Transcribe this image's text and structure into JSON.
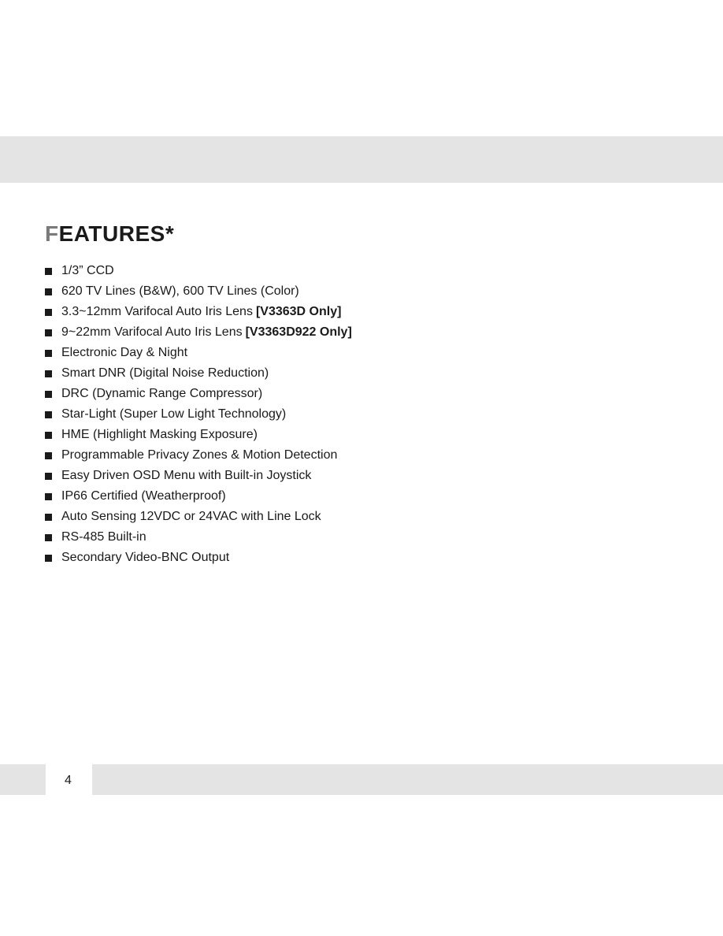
{
  "page": {
    "title_first_letter": "F",
    "title_rest": "EATURES*",
    "page_number": "4"
  },
  "features": [
    {
      "text": "1/3” CCD",
      "bold": ""
    },
    {
      "text": "620 TV Lines (B&W), 600 TV Lines (Color)",
      "bold": ""
    },
    {
      "text": "3.3~12mm Varifocal Auto Iris Lens",
      "bold": "[V3363D Only]"
    },
    {
      "text": "9~22mm Varifocal Auto Iris Lens",
      "bold": "[V3363D922 Only]"
    },
    {
      "text": "Electronic Day & Night",
      "bold": ""
    },
    {
      "text": "Smart DNR (Digital Noise Reduction)",
      "bold": ""
    },
    {
      "text": "DRC (Dynamic Range Compressor)",
      "bold": ""
    },
    {
      "text": "Star-Light (Super Low Light Technology)",
      "bold": ""
    },
    {
      "text": "HME (Highlight Masking Exposure)",
      "bold": ""
    },
    {
      "text": "Programmable Privacy Zones & Motion Detection",
      "bold": ""
    },
    {
      "text": "Easy Driven OSD Menu with Built-in Joystick",
      "bold": ""
    },
    {
      "text": "IP66 Certified (Weatherproof)",
      "bold": ""
    },
    {
      "text": "Auto Sensing 12VDC or 24VAC with Line Lock",
      "bold": ""
    },
    {
      "text": "RS-485 Built-in",
      "bold": ""
    },
    {
      "text": "Secondary Video-BNC Output",
      "bold": ""
    }
  ],
  "colors": {
    "band": "#e4e4e4",
    "title_accent": "#7a7a7a",
    "text": "#1a1a1a"
  }
}
